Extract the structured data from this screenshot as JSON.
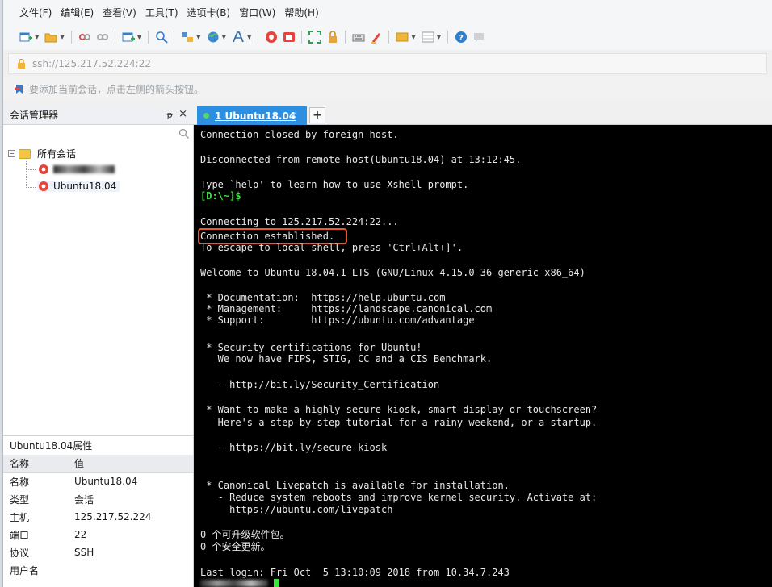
{
  "menu": [
    "文件(F)",
    "编辑(E)",
    "查看(V)",
    "工具(T)",
    "选项卡(B)",
    "窗口(W)",
    "帮助(H)"
  ],
  "toolbar": {
    "icons": [
      "new-session-icon",
      "open-folder-icon",
      "disconnect-icon",
      "reconnect-icon",
      "new-tab-icon",
      "find-icon",
      "transfer-icon",
      "globe-icon",
      "font-icon",
      "xshell-icon",
      "xftp-icon",
      "fullscreen-icon",
      "lock-icon",
      "keyboard-icon",
      "highlight-icon",
      "compose-icon",
      "layout-icon",
      "help-icon",
      "chat-icon"
    ]
  },
  "address": "ssh://125.217.52.224:22",
  "hint": "要添加当前会话，点击左侧的箭头按钮。",
  "session_manager": {
    "title": "会话管理器",
    "pin": "ᵽ",
    "close": "×",
    "root_label": "所有会话",
    "items": [
      {
        "label": "",
        "redacted": true
      },
      {
        "label": "Ubuntu18.04",
        "redacted": false
      }
    ]
  },
  "properties": {
    "title": "Ubuntu18.04属性",
    "header": {
      "key": "名称",
      "value": "值"
    },
    "rows": [
      {
        "key": "名称",
        "value": "Ubuntu18.04"
      },
      {
        "key": "类型",
        "value": "会话"
      },
      {
        "key": "主机",
        "value": "125.217.52.224"
      },
      {
        "key": "端口",
        "value": "22"
      },
      {
        "key": "协议",
        "value": "SSH"
      },
      {
        "key": "用户名",
        "value": ""
      }
    ]
  },
  "tabs": [
    {
      "label": "1 Ubuntu18.04",
      "active": true,
      "close": "×"
    }
  ],
  "tab_add": "+",
  "terminal": {
    "lines": [
      {
        "text": "Connection closed by foreign host.",
        "green": false
      },
      {
        "text": "Disconnected from remote host(Ubuntu18.04) at 13:12:45.",
        "green": false
      },
      {
        "text": "Type `help' to learn how to use Xshell prompt.",
        "green": false
      },
      {
        "text": "[D:\\~]$",
        "green": true
      },
      {
        "text": "Connecting to 125.217.52.224:22...",
        "green": false
      },
      {
        "text": "Connection established.",
        "green": false
      },
      {
        "text": "To escape to local shell, press 'Ctrl+Alt+]'.",
        "green": false
      },
      {
        "text": "Welcome to Ubuntu 18.04.1 LTS (GNU/Linux 4.15.0-36-generic x86_64)",
        "green": false
      },
      {
        "text": " * Documentation:  https://help.ubuntu.com",
        "green": false
      },
      {
        "text": " * Management:     https://landscape.canonical.com",
        "green": false
      },
      {
        "text": " * Support:        https://ubuntu.com/advantage",
        "green": false
      },
      {
        "text": " * Security certifications for Ubuntu!",
        "green": false
      },
      {
        "text": "   We now have FIPS, STIG, CC and a CIS Benchmark.",
        "green": false
      },
      {
        "text": "   - http://bit.ly/Security_Certification",
        "green": false
      },
      {
        "text": " * Want to make a highly secure kiosk, smart display or touchscreen?",
        "green": false
      },
      {
        "text": "   Here's a step-by-step tutorial for a rainy weekend, or a startup.",
        "green": false
      },
      {
        "text": "   - https://bit.ly/secure-kiosk",
        "green": false
      },
      {
        "text": " * Canonical Livepatch is available for installation.",
        "green": false
      },
      {
        "text": "   - Reduce system reboots and improve kernel security. Activate at:",
        "green": false
      },
      {
        "text": "     https://ubuntu.com/livepatch",
        "green": false
      },
      {
        "text": "0 个可升级软件包。",
        "green": false
      },
      {
        "text": "0 个安全更新。",
        "green": false
      },
      {
        "text": "Last login: Fri Oct  5 13:10:09 2018 from 10.34.7.243",
        "green": false
      }
    ]
  },
  "colors": {
    "tab_active": "#2e8fe0",
    "terminal_bg": "#000000",
    "prompt_green": "#39e639",
    "highlight_box": "#e85a2c"
  }
}
